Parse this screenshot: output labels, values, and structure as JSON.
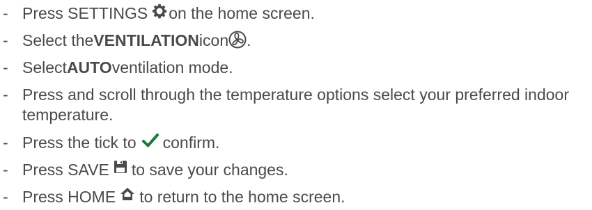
{
  "steps": [
    {
      "dash": "-",
      "t1": "Press SETTINGS",
      "icon": "gear-icon",
      "t2": " on the home screen."
    },
    {
      "dash": "-",
      "t1": "Select the ",
      "bold": "VENTILATION",
      "t2": " icon ",
      "icon": "fan-icon",
      "t3": "."
    },
    {
      "dash": "-",
      "t1": "Select ",
      "bold": "AUTO",
      "t2": " ventilation mode."
    },
    {
      "dash": "-",
      "text": "Press and scroll through the temperature options select your preferred indoor temperature."
    },
    {
      "dash": "-",
      "t1": "Press the tick to",
      "icon": "checkmark-icon",
      "t2": "confirm."
    },
    {
      "dash": "-",
      "t1": "Press SAVE",
      "icon": "save-icon",
      "t2": "to save your changes."
    },
    {
      "dash": "-",
      "t1": "Press HOME",
      "icon": "home-icon",
      "t2": "to return to the home screen."
    }
  ],
  "colors": {
    "text": "#4a4a4a",
    "checkmark": "#1f7a3e"
  }
}
